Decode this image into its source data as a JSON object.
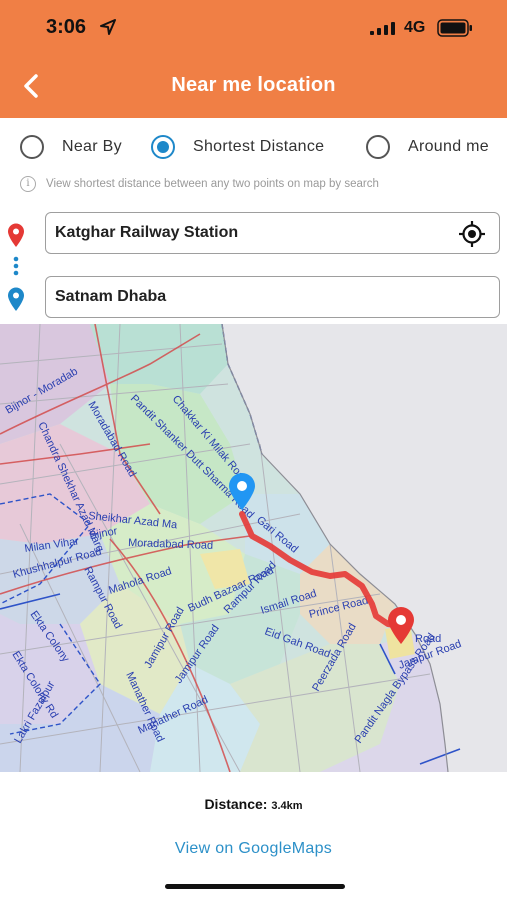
{
  "status_bar": {
    "time": "3:06",
    "network": "4G"
  },
  "header": {
    "title": "Near me location"
  },
  "modes": [
    {
      "label": "Near By",
      "selected": false
    },
    {
      "label": "Shortest Distance",
      "selected": true
    },
    {
      "label": "Around me",
      "selected": false
    }
  ],
  "hint": "View shortest distance between any two points on map by search",
  "origin": {
    "value": "Katghar Railway Station"
  },
  "destination": {
    "value": "Satnam Dhaba"
  },
  "map": {
    "route_color": "#e53935",
    "labels": [
      "Bijnor - Moradab",
      "Moradabad Road",
      "Pandit Shanker Dutt Sharma Road",
      "Chakkar Ki Milak Road",
      "Chandra Shekhar Azad Marg",
      "Sheikhar Azad Ma",
      "Bijnor",
      "Moradabad Road",
      "Gari Road",
      "Milan Vihar",
      "Khushhalpur Road",
      "Mahola Road",
      "Rampur Road",
      "Budh Bazaar Road",
      "Ismail Road",
      "Prince Road",
      "Eid Gah Road",
      "Rampur Road",
      "Peerzada Road",
      "Jamipur Road",
      "Jamipur Road",
      "Ekta Colony",
      "Ekta Colony Rd",
      "Lakri Fazalpur",
      "Manather Road",
      "Manather Road",
      "Pandit Nagla Bypass Road",
      "Jampur Road",
      "Road"
    ]
  },
  "distance": {
    "label": "Distance:",
    "value": "3.4km"
  },
  "link": {
    "label": "View on GoogleMaps"
  }
}
